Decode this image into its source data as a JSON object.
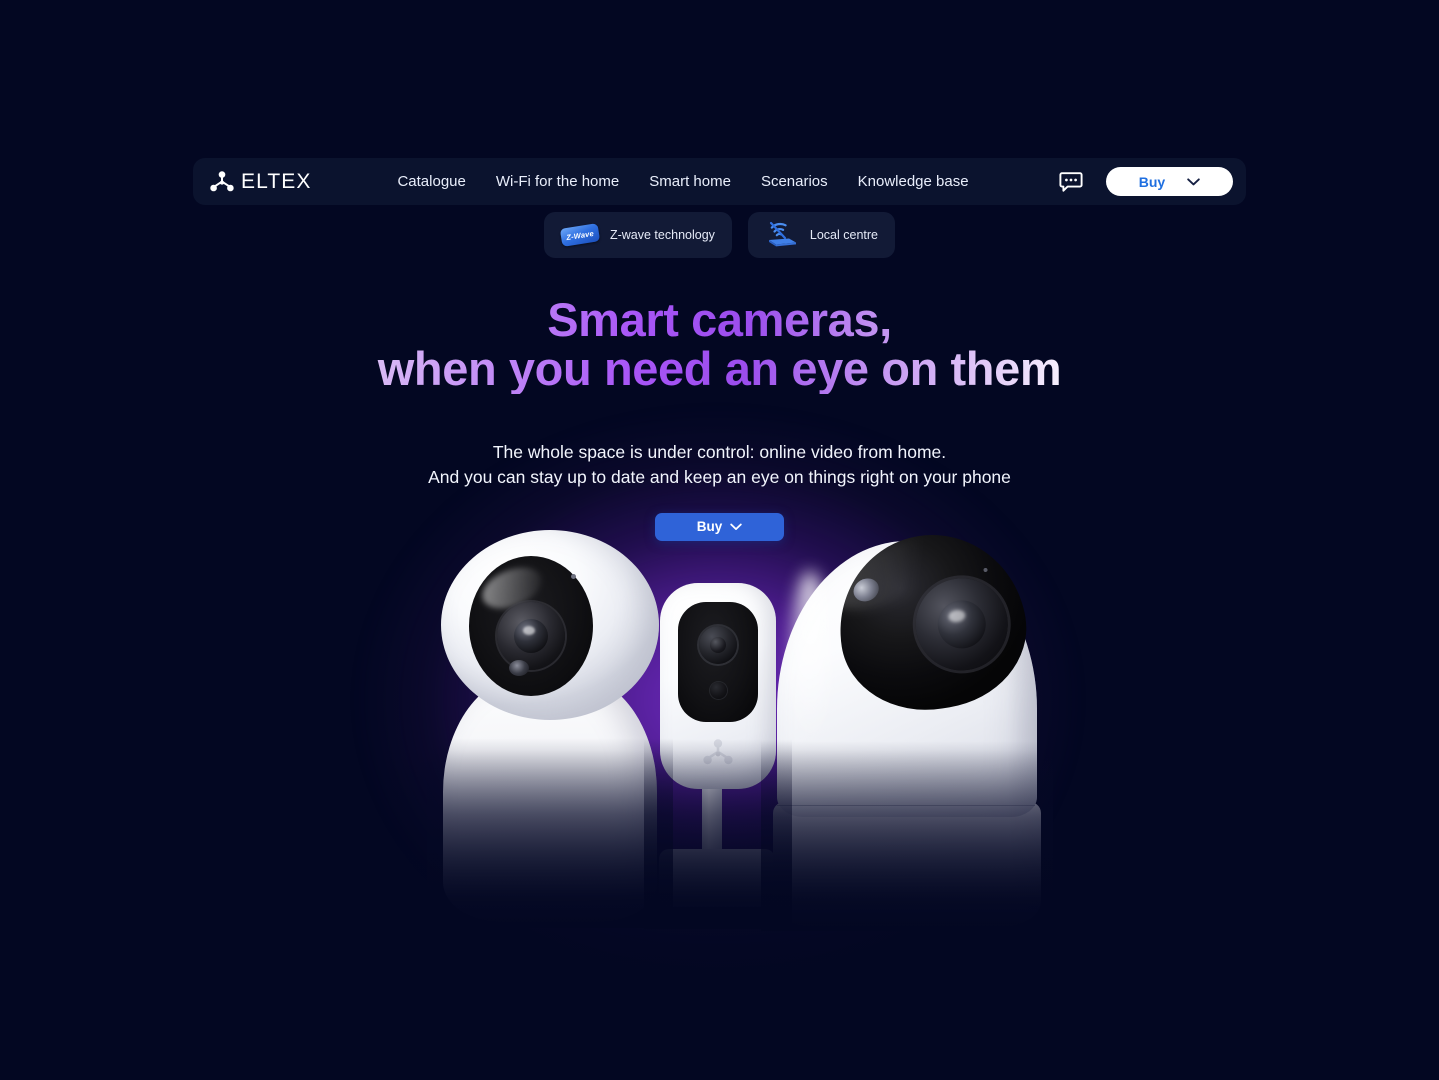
{
  "brand": {
    "name": "ELTEX",
    "logo_icon": "eltex-molecule-logo"
  },
  "nav": {
    "links": [
      {
        "label": "Catalogue"
      },
      {
        "label": "Wi-Fi for the home"
      },
      {
        "label": "Smart home"
      },
      {
        "label": "Scenarios"
      },
      {
        "label": "Knowledge base"
      }
    ],
    "chat_icon": "chat-bubble-icon",
    "buy_button": {
      "label": "Buy",
      "chevron_icon": "chevron-down-icon"
    }
  },
  "badges": [
    {
      "label": "Z-wave technology",
      "icon": "z-wave-chip-icon",
      "chip_text": "Z-Wave"
    },
    {
      "label": "Local centre",
      "icon": "router-wifi-icon"
    }
  ],
  "hero": {
    "headline_line1": "Smart cameras,",
    "headline_line2": "when you need an eye on them",
    "subtitle_line1": "The whole space is under control: online video from home.",
    "subtitle_line2": "And you can stay up to date and keep an eye on things right on your phone",
    "buy_button": {
      "label": "Buy",
      "chevron_icon": "chevron-down-icon"
    }
  },
  "product_image": {
    "cameras": [
      {
        "name": "dome-pan-tilt-camera-left"
      },
      {
        "name": "compact-rectangular-camera-middle"
      },
      {
        "name": "dome-pan-tilt-camera-right"
      }
    ]
  },
  "colors": {
    "page_background": "#030722",
    "nav_background": "#0b132e",
    "badge_background": "#121a36",
    "accent_purple": "#a855f7",
    "accent_blue": "#2f63d8",
    "buy_text_blue": "#1f6fe0",
    "glow_purple": "#782dcd"
  }
}
